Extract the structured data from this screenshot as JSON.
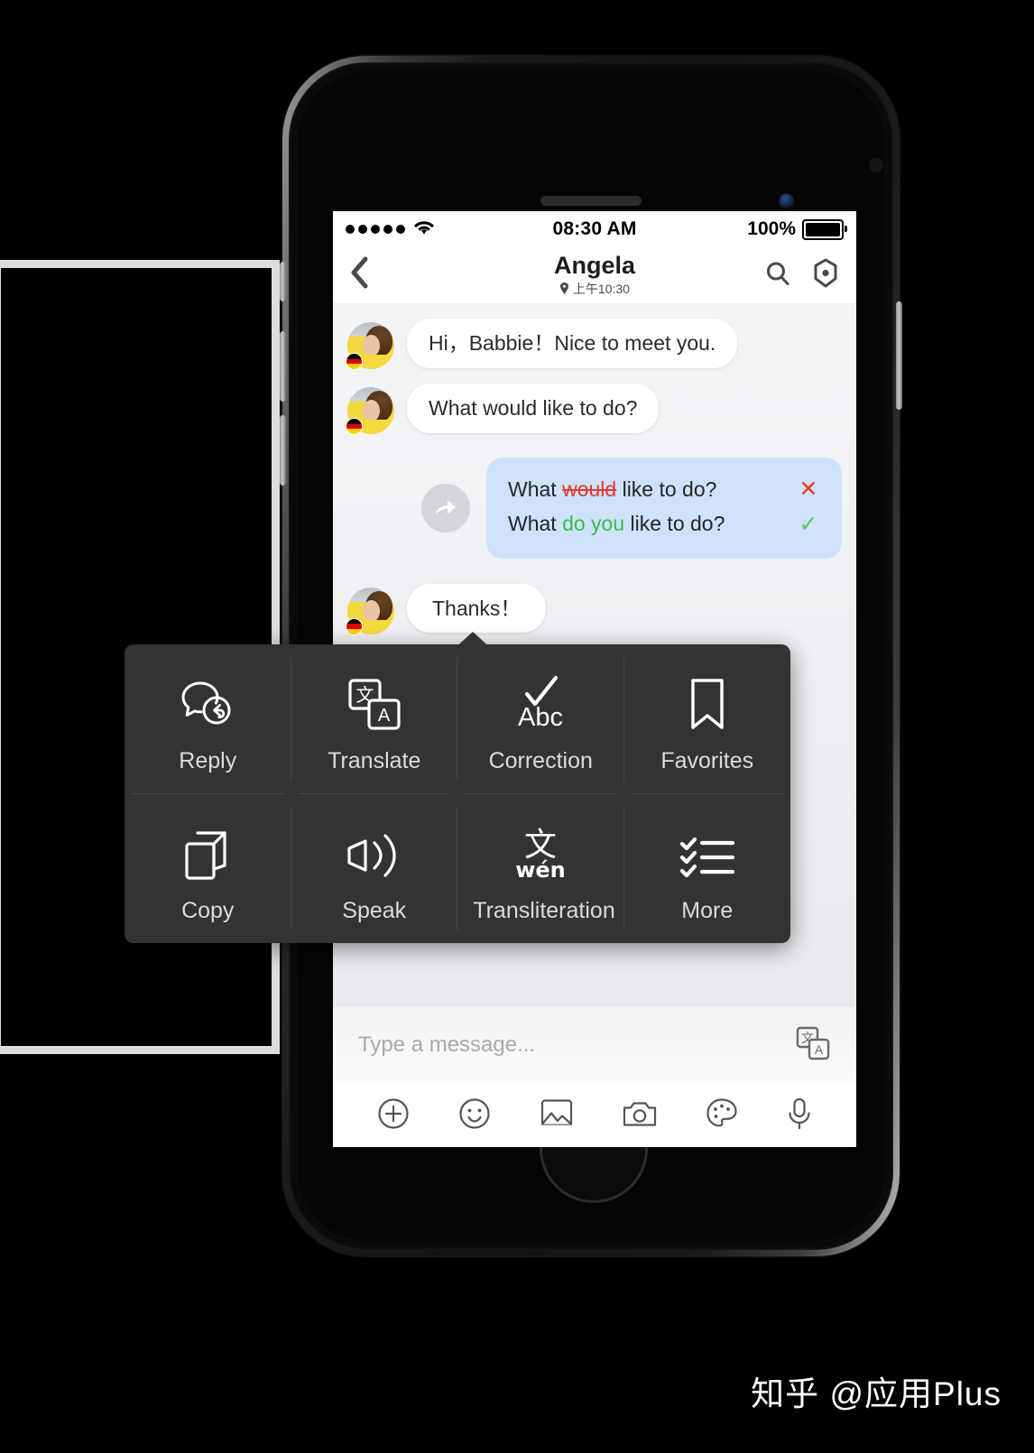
{
  "status_bar": {
    "signal_dots": 5,
    "wifi_icon": "wifi-icon",
    "time": "08:30 AM",
    "battery_percent": "100%"
  },
  "nav_bar": {
    "back_icon": "chevron-left-icon",
    "title": "Angela",
    "subtitle": "上午10:30",
    "location_icon": "location-pin-icon",
    "search_icon": "search-icon",
    "profile_icon": "hexagon-target-icon"
  },
  "chat": {
    "messages": [
      {
        "id": "msg-1",
        "side": "them",
        "text": "Hi，Babbie！Nice to meet you.",
        "avatar": "angela-avatar",
        "flag": "germany-flag"
      },
      {
        "id": "msg-2",
        "side": "them",
        "text": "What would like to do?",
        "avatar": "angela-avatar",
        "flag": "germany-flag"
      },
      {
        "id": "msg-4",
        "side": "them",
        "text": "Thanks！",
        "avatar": "angela-avatar",
        "flag": "germany-flag"
      }
    ],
    "correction": {
      "forward_icon": "forward-arrow-icon",
      "wrong": {
        "prefix": "What ",
        "error": "would",
        "suffix": " like to do?",
        "mark": "✕",
        "mark_color": "#e8392c"
      },
      "right": {
        "prefix": "What ",
        "fix": "do you",
        "suffix": " like to do?",
        "mark": "✓",
        "mark_color": "#54c94a"
      }
    }
  },
  "action_menu": {
    "items": [
      {
        "label": "Reply",
        "icon": "reply-bubble-icon"
      },
      {
        "label": "Translate",
        "icon": "translate-icon"
      },
      {
        "label": "Correction",
        "icon": "check-abc-icon"
      },
      {
        "label": "Favorites",
        "icon": "bookmark-icon"
      },
      {
        "label": "Copy",
        "icon": "copy-icon"
      },
      {
        "label": "Speak",
        "icon": "speaker-icon"
      },
      {
        "label": "Transliteration",
        "icon": "wen-pinyin-icon"
      },
      {
        "label": "More",
        "icon": "checklist-icon"
      }
    ]
  },
  "input_bar": {
    "placeholder": "Type a message...",
    "translate_icon": "translate-icon"
  },
  "toolbar": {
    "items": [
      {
        "name": "plus-circle-icon"
      },
      {
        "name": "smiley-icon"
      },
      {
        "name": "image-icon"
      },
      {
        "name": "camera-icon"
      },
      {
        "name": "palette-icon"
      },
      {
        "name": "microphone-icon"
      }
    ]
  },
  "watermark": {
    "text": "知乎 @应用Plus"
  },
  "colors": {
    "menu_bg": "#333334",
    "correction_bubble": "#cfe2fb",
    "error_red": "#e03b34",
    "fix_green": "#35c04a",
    "chat_bg": "#f1f2f4"
  }
}
